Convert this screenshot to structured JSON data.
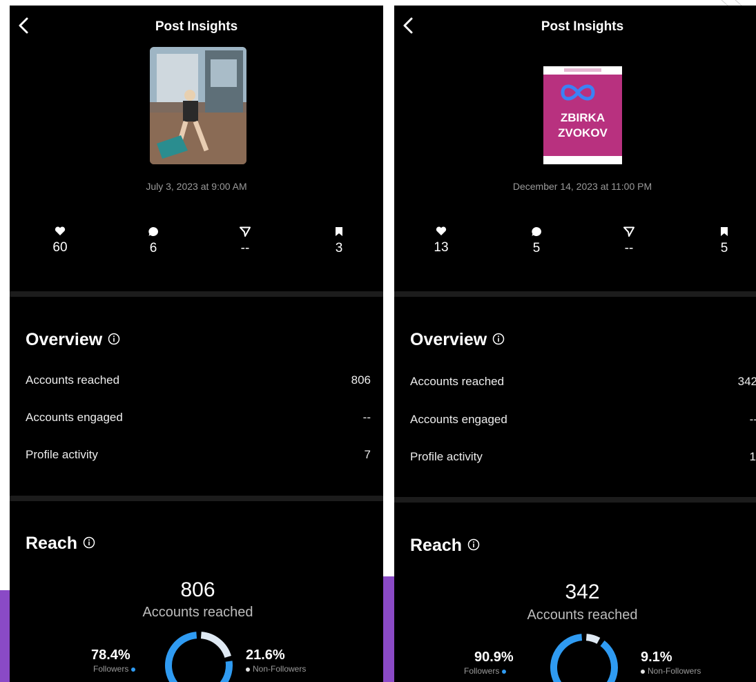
{
  "left": {
    "title": "Post Insights",
    "date": "July 3, 2023 at 9:00 AM",
    "metrics": {
      "likes": "60",
      "comments": "6",
      "shares": "--",
      "saves": "3"
    },
    "overview": {
      "title": "Overview",
      "rows": [
        {
          "label": "Accounts reached",
          "value": "806"
        },
        {
          "label": "Accounts engaged",
          "value": "--"
        },
        {
          "label": "Profile activity",
          "value": "7"
        }
      ]
    },
    "reach": {
      "title": "Reach",
      "number": "806",
      "sub": "Accounts reached",
      "followers_pct": "78.4%",
      "followers_label": "Followers",
      "nonfollowers_pct": "21.6%",
      "nonfollowers_label": "Non-Followers",
      "followers_fraction": 0.784
    }
  },
  "right": {
    "title": "Post Insights",
    "date": "December 14, 2023 at 11:00 PM",
    "thumb_line1": "ZBIRKA",
    "thumb_line2": "ZVOKOV",
    "metrics": {
      "likes": "13",
      "comments": "5",
      "shares": "--",
      "saves": "5"
    },
    "overview": {
      "title": "Overview",
      "rows": [
        {
          "label": "Accounts reached",
          "value": "342"
        },
        {
          "label": "Accounts engaged",
          "value": "--"
        },
        {
          "label": "Profile activity",
          "value": "1"
        }
      ]
    },
    "reach": {
      "title": "Reach",
      "number": "342",
      "sub": "Accounts reached",
      "followers_pct": "90.9%",
      "followers_label": "Followers",
      "nonfollowers_pct": "9.1%",
      "nonfollowers_label": "Non-Followers",
      "followers_fraction": 0.909
    }
  },
  "colors": {
    "followers": "#2f9bf2",
    "non_followers": "#dfe9f3",
    "accent_purple": "#8a4ac6",
    "accent_pink": "#b8317f"
  }
}
